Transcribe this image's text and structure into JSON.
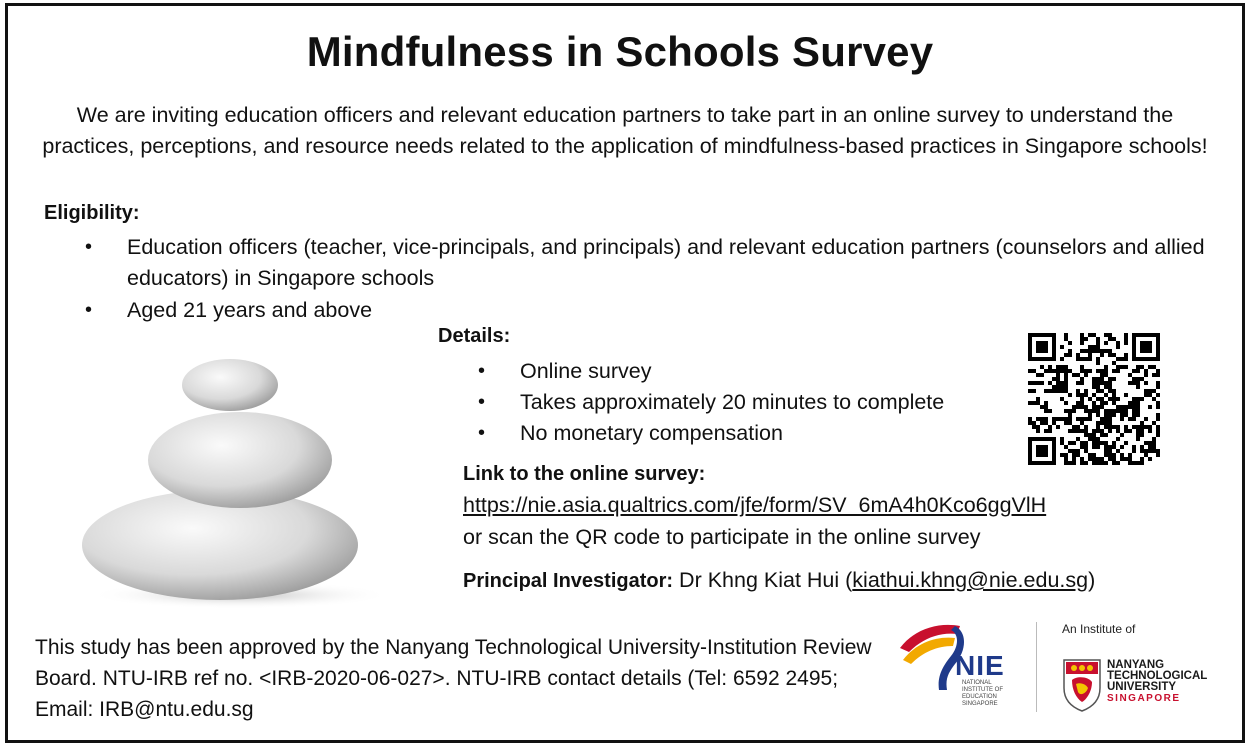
{
  "title": "Mindfulness in Schools Survey",
  "intro": "We are inviting education officers and relevant education partners to take part in an online survey to understand the practices, perceptions, and resource needs related to the application of mindfulness-based practices in Singapore schools!",
  "eligibility": {
    "heading": "Eligibility:",
    "items": [
      "Education officers (teacher, vice-principals, and principals) and relevant education partners (counselors and allied educators) in Singapore schools",
      "Aged 21 years and above"
    ]
  },
  "details": {
    "heading": "Details:",
    "items": [
      "Online survey",
      "Takes approximately 20 minutes to complete",
      "No monetary compensation"
    ]
  },
  "link": {
    "heading": "Link to the online survey:",
    "url": "https://nie.asia.qualtrics.com/jfe/form/SV_6mA4h0Kco6ggVlH",
    "note": "or scan the QR code to participate in the online survey"
  },
  "pi": {
    "label": "Principal Investigator:",
    "name": " Dr Khng Kiat Hui (",
    "email": "kiathui.khng@nie.edu.sg",
    "close": ")"
  },
  "approval": "This study has been approved by the Nanyang Technological University-Institution Review Board. NTU-IRB ref no. <IRB-2020-06-027>. NTU-IRB contact details (Tel: 6592 2495; Email: IRB@ntu.edu.sg",
  "logos": {
    "nie": "NIE",
    "nie_sub": [
      "NATIONAL",
      "INSTITUTE OF",
      "EDUCATION",
      "SINGAPORE"
    ],
    "institute_of": "An Institute of",
    "ntu": [
      "NANYANG",
      "TECHNOLOGICAL",
      "UNIVERSITY"
    ],
    "ntu_sg": "SINGAPORE"
  },
  "bullet": "•"
}
